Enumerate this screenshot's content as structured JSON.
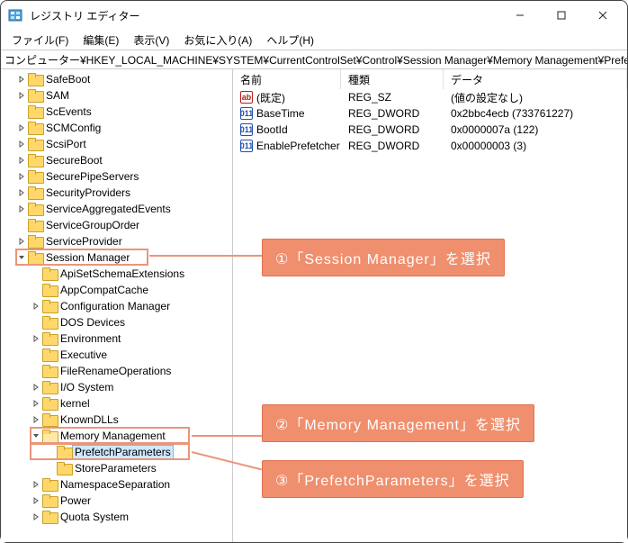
{
  "window": {
    "title": "レジストリ エディター"
  },
  "menu": {
    "file": "ファイル(F)",
    "edit": "編集(E)",
    "view": "表示(V)",
    "fav": "お気に入り(A)",
    "help": "ヘルプ(H)"
  },
  "address": "コンピューター¥HKEY_LOCAL_MACHINE¥SYSTEM¥CurrentControlSet¥Control¥Session Manager¥Memory Management¥PrefetchParame",
  "tree": [
    {
      "lv": 1,
      "expand": ">",
      "label": "SafeBoot"
    },
    {
      "lv": 1,
      "expand": ">",
      "label": "SAM"
    },
    {
      "lv": 1,
      "expand": "",
      "label": "ScEvents"
    },
    {
      "lv": 1,
      "expand": ">",
      "label": "SCMConfig"
    },
    {
      "lv": 1,
      "expand": ">",
      "label": "ScsiPort"
    },
    {
      "lv": 1,
      "expand": ">",
      "label": "SecureBoot"
    },
    {
      "lv": 1,
      "expand": ">",
      "label": "SecurePipeServers"
    },
    {
      "lv": 1,
      "expand": ">",
      "label": "SecurityProviders"
    },
    {
      "lv": 1,
      "expand": ">",
      "label": "ServiceAggregatedEvents"
    },
    {
      "lv": 1,
      "expand": "",
      "label": "ServiceGroupOrder"
    },
    {
      "lv": 1,
      "expand": ">",
      "label": "ServiceProvider"
    },
    {
      "lv": 1,
      "expand": "v",
      "label": "Session Manager",
      "box": 1
    },
    {
      "lv": 2,
      "expand": "",
      "label": "ApiSetSchemaExtensions"
    },
    {
      "lv": 2,
      "expand": "",
      "label": "AppCompatCache"
    },
    {
      "lv": 2,
      "expand": ">",
      "label": "Configuration Manager"
    },
    {
      "lv": 2,
      "expand": "",
      "label": "DOS Devices"
    },
    {
      "lv": 2,
      "expand": ">",
      "label": "Environment"
    },
    {
      "lv": 2,
      "expand": "",
      "label": "Executive"
    },
    {
      "lv": 2,
      "expand": "",
      "label": "FileRenameOperations"
    },
    {
      "lv": 2,
      "expand": ">",
      "label": "I/O System"
    },
    {
      "lv": 2,
      "expand": ">",
      "label": "kernel"
    },
    {
      "lv": 2,
      "expand": ">",
      "label": "KnownDLLs"
    },
    {
      "lv": 2,
      "expand": "v",
      "label": "Memory Management",
      "box": 2,
      "open": true
    },
    {
      "lv": 3,
      "expand": "",
      "label": "PrefetchParameters",
      "selected": true,
      "box": 3
    },
    {
      "lv": 3,
      "expand": "",
      "label": "StoreParameters"
    },
    {
      "lv": 2,
      "expand": ">",
      "label": "NamespaceSeparation"
    },
    {
      "lv": 2,
      "expand": ">",
      "label": "Power"
    },
    {
      "lv": 2,
      "expand": ">",
      "label": "Quota System"
    }
  ],
  "columns": {
    "name": "名前",
    "type": "種類",
    "data": "データ"
  },
  "values": [
    {
      "icon": "sz",
      "name": "(既定)",
      "type": "REG_SZ",
      "data": "(値の設定なし)"
    },
    {
      "icon": "dw",
      "name": "BaseTime",
      "type": "REG_DWORD",
      "data": "0x2bbc4ecb (733761227)"
    },
    {
      "icon": "dw",
      "name": "BootId",
      "type": "REG_DWORD",
      "data": "0x0000007a (122)"
    },
    {
      "icon": "dw",
      "name": "EnablePrefetcher",
      "type": "REG_DWORD",
      "data": "0x00000003 (3)"
    }
  ],
  "annotations": {
    "a1": "①「Session Manager」を選択",
    "a2": "②「Memory  Management」を選択",
    "a3": "③「PrefetchParameters」を選択"
  }
}
